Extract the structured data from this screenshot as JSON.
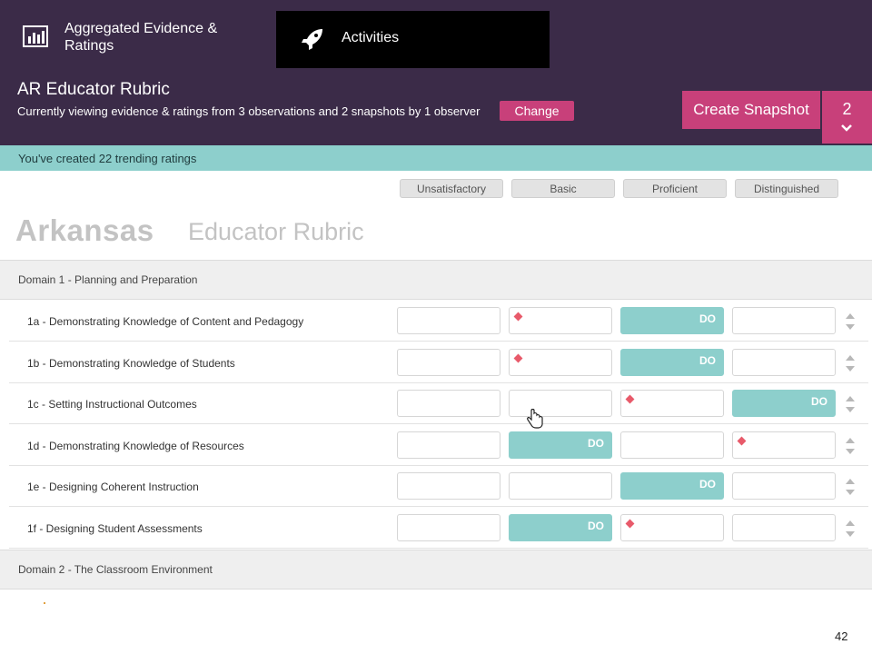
{
  "nav": {
    "tab_evidence": "Aggregated Evidence & Ratings",
    "tab_activities": "Activities"
  },
  "header": {
    "title": "AR Educator Rubric",
    "subtitle": "Currently viewing evidence & ratings from 3 observations and 2 snapshots by 1 observer",
    "change_label": "Change",
    "create_snapshot_label": "Create Snapshot",
    "snapshot_count": "2"
  },
  "banner": {
    "text": "You've created 22 trending ratings"
  },
  "levels": [
    "Unsatisfactory",
    "Basic",
    "Proficient",
    "Distinguished"
  ],
  "rubric": {
    "state": "Arkansas",
    "name": "Educator Rubric"
  },
  "domains": [
    {
      "label": "Domain 1 - Planning and Preparation",
      "components": [
        {
          "label": "1a - Demonstrating Knowledge of Content and Pedagogy",
          "rating": 2,
          "marker": 1
        },
        {
          "label": "1b - Demonstrating Knowledge of Students",
          "rating": 2,
          "marker": 1
        },
        {
          "label": "1c - Setting Instructional Outcomes",
          "rating": 3,
          "marker": 2
        },
        {
          "label": "1d - Demonstrating Knowledge of Resources",
          "rating": 1,
          "marker": 3
        },
        {
          "label": "1e - Designing Coherent Instruction",
          "rating": 2,
          "marker": null
        },
        {
          "label": "1f - Designing Student Assessments",
          "rating": 1,
          "marker": 2
        }
      ]
    },
    {
      "label": "Domain 2 - The Classroom Environment",
      "components": []
    }
  ],
  "rating_label": "DO",
  "page_number": "42",
  "colors": {
    "nav_bg": "#3b2b48",
    "accent": "#c8407a",
    "teal": "#8dcfcc",
    "marker": "#e85a6a"
  }
}
